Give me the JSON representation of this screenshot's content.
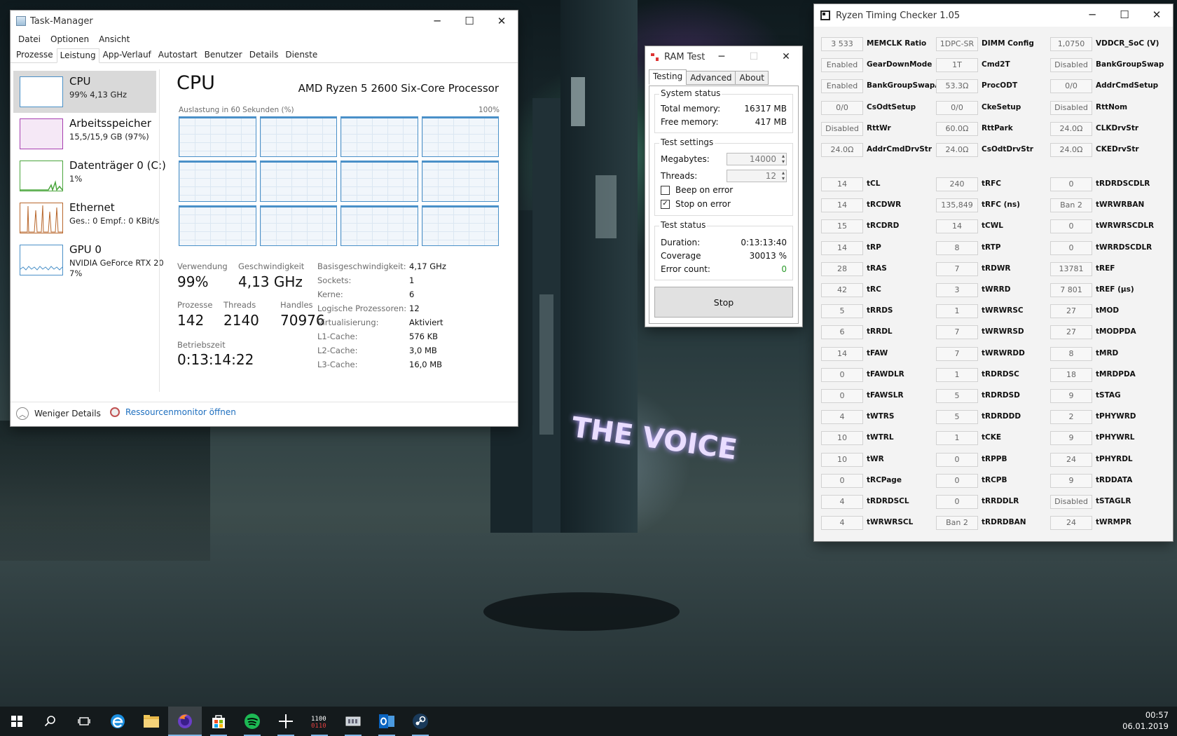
{
  "taskmanager": {
    "title": "Task-Manager",
    "menu": [
      "Datei",
      "Optionen",
      "Ansicht"
    ],
    "tabs": [
      "Prozesse",
      "Leistung",
      "App-Verlauf",
      "Autostart",
      "Benutzer",
      "Details",
      "Dienste"
    ],
    "active_tab": "Leistung",
    "sidebar": [
      {
        "name": "CPU",
        "sub1": "99% 4,13 GHz",
        "sub2": ""
      },
      {
        "name": "Arbeitsspeicher",
        "sub1": "15,5/15,9 GB (97%)",
        "sub2": ""
      },
      {
        "name": "Datenträger 0 (C:)",
        "sub1": "1%",
        "sub2": ""
      },
      {
        "name": "Ethernet",
        "sub1": "Ges.: 0 Empf.: 0 KBit/s",
        "sub2": ""
      },
      {
        "name": "GPU 0",
        "sub1": "NVIDIA GeForce RTX 20",
        "sub2": "7%"
      }
    ],
    "cpu_title": "CPU",
    "cpu_model": "AMD Ryzen 5 2600 Six-Core Processor",
    "graph_label": "Auslastung in 60 Sekunden (%)",
    "graph_max": "100%",
    "stats": {
      "usage_label": "Verwendung",
      "usage_value": "99%",
      "speed_label": "Geschwindigkeit",
      "speed_value": "4,13 GHz",
      "proc_label": "Prozesse",
      "proc_value": "142",
      "threads_label": "Threads",
      "threads_value": "2140",
      "handles_label": "Handles",
      "handles_value": "70976",
      "uptime_label": "Betriebszeit",
      "uptime_value": "0:13:14:22"
    },
    "specs": [
      {
        "k": "Basisgeschwindigkeit:",
        "v": "4,17 GHz"
      },
      {
        "k": "Sockets:",
        "v": "1"
      },
      {
        "k": "Kerne:",
        "v": "6"
      },
      {
        "k": "Logische Prozessoren:",
        "v": "12"
      },
      {
        "k": "Virtualisierung:",
        "v": "Aktiviert"
      },
      {
        "k": "L1-Cache:",
        "v": "576 KB"
      },
      {
        "k": "L2-Cache:",
        "v": "3,0 MB"
      },
      {
        "k": "L3-Cache:",
        "v": "16,0 MB"
      }
    ],
    "footer_less": "Weniger Details",
    "footer_res": "Ressourcenmonitor öffnen"
  },
  "ramtest": {
    "title": "RAM Test",
    "tabs": [
      "Testing",
      "Advanced",
      "About"
    ],
    "system_status": "System status",
    "total_label": "Total memory:",
    "total_value": "16317 MB",
    "free_label": "Free memory:",
    "free_value": "417 MB",
    "test_settings": "Test settings",
    "mb_label": "Megabytes:",
    "mb_value": "14000",
    "threads_label": "Threads:",
    "threads_value": "12",
    "beep_label": "Beep on error",
    "beep_checked": false,
    "stop_label": "Stop on error",
    "stop_checked": true,
    "test_status": "Test status",
    "duration_label": "Duration:",
    "duration_value": "0:13:13:40",
    "coverage_label": "Coverage",
    "coverage_value": "30013 %",
    "errors_label": "Error count:",
    "errors_value": "0",
    "stop_button": "Stop",
    "error_color": "#2a9a2a"
  },
  "rtc": {
    "title": "Ryzen Timing Checker 1.05",
    "top_rows": [
      [
        {
          "v": "3 533",
          "l": "MEMCLK Ratio"
        },
        {
          "v": "1DPC-SR",
          "l": "DIMM Config"
        },
        {
          "v": "1,0750",
          "l": "VDDCR_SoC (V)"
        }
      ],
      [
        {
          "v": "Enabled",
          "l": "GearDownMode"
        },
        {
          "v": "1T",
          "l": "Cmd2T"
        },
        {
          "v": "Disabled",
          "l": "BankGroupSwap"
        }
      ],
      [
        {
          "v": "Enabled",
          "l": "BankGroupSwapAlt"
        },
        {
          "v": "53.3Ω",
          "l": "ProcODT"
        },
        {
          "v": "0/0",
          "l": "AddrCmdSetup"
        }
      ],
      [
        {
          "v": "0/0",
          "l": "CsOdtSetup"
        },
        {
          "v": "0/0",
          "l": "CkeSetup"
        },
        {
          "v": "Disabled",
          "l": "RttNom"
        }
      ],
      [
        {
          "v": "Disabled",
          "l": "RttWr"
        },
        {
          "v": "60.0Ω",
          "l": "RttPark"
        },
        {
          "v": "24.0Ω",
          "l": "CLKDrvStr"
        }
      ],
      [
        {
          "v": "24.0Ω",
          "l": "AddrCmdDrvStr"
        },
        {
          "v": "24.0Ω",
          "l": "CsOdtDrvStr"
        },
        {
          "v": "24.0Ω",
          "l": "CKEDrvStr"
        }
      ]
    ],
    "bottom_rows": [
      [
        {
          "v": "14",
          "l": "tCL"
        },
        {
          "v": "240",
          "l": "tRFC"
        },
        {
          "v": "0",
          "l": "tRDRDSCDLR"
        }
      ],
      [
        {
          "v": "14",
          "l": "tRCDWR"
        },
        {
          "v": "135,849",
          "l": "tRFC (ns)"
        },
        {
          "v": "Ban 2",
          "l": "tWRWRBAN"
        }
      ],
      [
        {
          "v": "15",
          "l": "tRCDRD"
        },
        {
          "v": "14",
          "l": "tCWL"
        },
        {
          "v": "0",
          "l": "tWRWRSCDLR"
        }
      ],
      [
        {
          "v": "14",
          "l": "tRP"
        },
        {
          "v": "8",
          "l": "tRTP"
        },
        {
          "v": "0",
          "l": "tWRRDSCDLR"
        }
      ],
      [
        {
          "v": "28",
          "l": "tRAS"
        },
        {
          "v": "7",
          "l": "tRDWR"
        },
        {
          "v": "13781",
          "l": "tREF"
        }
      ],
      [
        {
          "v": "42",
          "l": "tRC"
        },
        {
          "v": "3",
          "l": "tWRRD"
        },
        {
          "v": "7 801",
          "l": "tREF (µs)"
        }
      ],
      [
        {
          "v": "5",
          "l": "tRRDS"
        },
        {
          "v": "1",
          "l": "tWRWRSC"
        },
        {
          "v": "27",
          "l": "tMOD"
        }
      ],
      [
        {
          "v": "6",
          "l": "tRRDL"
        },
        {
          "v": "7",
          "l": "tWRWRSD"
        },
        {
          "v": "27",
          "l": "tMODPDA"
        }
      ],
      [
        {
          "v": "14",
          "l": "tFAW"
        },
        {
          "v": "7",
          "l": "tWRWRDD"
        },
        {
          "v": "8",
          "l": "tMRD"
        }
      ],
      [
        {
          "v": "0",
          "l": "tFAWDLR"
        },
        {
          "v": "1",
          "l": "tRDRDSC"
        },
        {
          "v": "18",
          "l": "tMRDPDA"
        }
      ],
      [
        {
          "v": "0",
          "l": "tFAWSLR"
        },
        {
          "v": "5",
          "l": "tRDRDSD"
        },
        {
          "v": "9",
          "l": "tSTAG"
        }
      ],
      [
        {
          "v": "4",
          "l": "tWTRS"
        },
        {
          "v": "5",
          "l": "tRDRDDD"
        },
        {
          "v": "2",
          "l": "tPHYWRD"
        }
      ],
      [
        {
          "v": "10",
          "l": "tWTRL"
        },
        {
          "v": "1",
          "l": "tCKE"
        },
        {
          "v": "9",
          "l": "tPHYWRL"
        }
      ],
      [
        {
          "v": "10",
          "l": "tWR"
        },
        {
          "v": "0",
          "l": "tRPPB"
        },
        {
          "v": "24",
          "l": "tPHYRDL"
        }
      ],
      [
        {
          "v": "0",
          "l": "tRCPage"
        },
        {
          "v": "0",
          "l": "tRCPB"
        },
        {
          "v": "9",
          "l": "tRDDATA"
        }
      ],
      [
        {
          "v": "4",
          "l": "tRDRDSCL"
        },
        {
          "v": "0",
          "l": "tRRDDLR"
        },
        {
          "v": "Disabled",
          "l": "tSTAGLR"
        }
      ],
      [
        {
          "v": "4",
          "l": "tWRWRSCL"
        },
        {
          "v": "Ban 2",
          "l": "tRDRDBAN"
        },
        {
          "v": "24",
          "l": "tWRMPR"
        }
      ]
    ]
  },
  "wallpaper_sign": "THE VOICE",
  "taskbar": {
    "icons": [
      "start-icon",
      "search-icon",
      "task-view-icon",
      "edge-icon",
      "explorer-icon",
      "firefox-icon",
      "store-icon",
      "spotify-icon",
      "app-cross-icon",
      "calculator-icon",
      "ramtest-icon",
      "outlook-icon",
      "steam-icon"
    ],
    "time": "00:57",
    "date": "06.01.2019"
  }
}
